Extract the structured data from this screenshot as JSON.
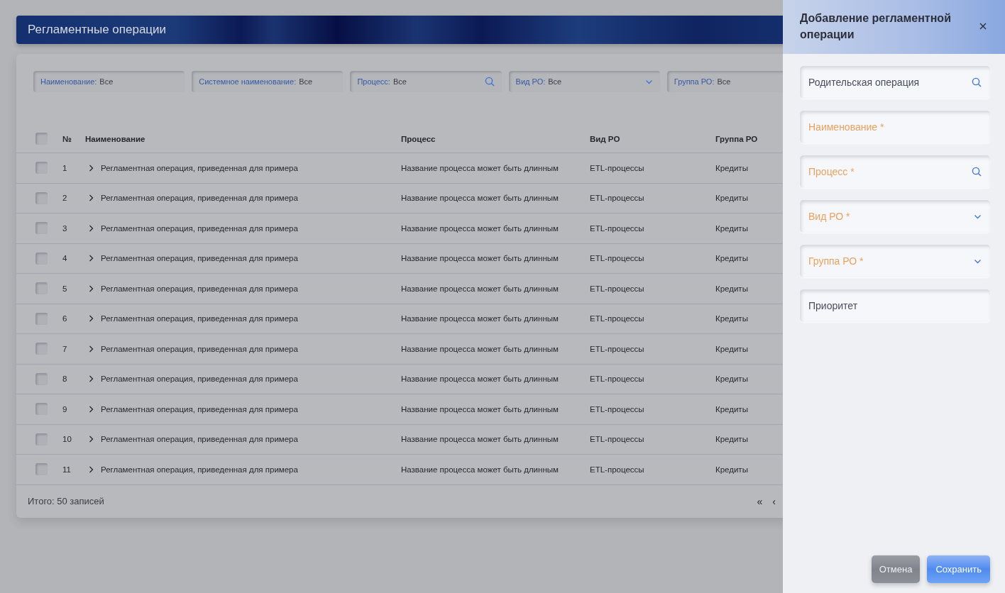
{
  "page": {
    "title": "Регламентные операции"
  },
  "filters": [
    {
      "label": "Наименование:",
      "value": "Все",
      "kind": "text"
    },
    {
      "label": "Системное наименование:",
      "value": "Все",
      "kind": "text"
    },
    {
      "label": "Процесс:",
      "value": "Все",
      "kind": "search"
    },
    {
      "label": "Вид РО:",
      "value": "Все",
      "kind": "dropdown"
    },
    {
      "label": "Группа РО:",
      "value": "Все",
      "kind": "text"
    }
  ],
  "table": {
    "select_all": {
      "checked": false
    },
    "columns": [
      "№",
      "Наименование",
      "Процесс",
      "Вид РО",
      "Группа РО"
    ],
    "rows": [
      {
        "checked": false,
        "expanded": false,
        "cells": [
          "1",
          "Регламентная операция, приведенная для примера",
          "Название процесса может быть длинным",
          "ETL-процессы",
          "Кредиты"
        ]
      },
      {
        "checked": false,
        "expanded": false,
        "cells": [
          "2",
          "Регламентная операция, приведенная для примера",
          "Название процесса может быть длинным",
          "ETL-процессы",
          "Кредиты"
        ]
      },
      {
        "checked": false,
        "expanded": false,
        "cells": [
          "3",
          "Регламентная операция, приведенная для примера",
          "Название процесса может быть длинным",
          "ETL-процессы",
          "Кредиты"
        ]
      },
      {
        "checked": false,
        "expanded": false,
        "cells": [
          "4",
          "Регламентная операция, приведенная для примера",
          "Название процесса может быть длинным",
          "ETL-процессы",
          "Кредиты"
        ]
      },
      {
        "checked": false,
        "expanded": false,
        "cells": [
          "5",
          "Регламентная операция, приведенная для примера",
          "Название процесса может быть длинным",
          "ETL-процессы",
          "Кредиты"
        ]
      },
      {
        "checked": false,
        "expanded": false,
        "cells": [
          "6",
          "Регламентная операция, приведенная для примера",
          "Название процесса может быть длинным",
          "ETL-процессы",
          "Кредиты"
        ]
      },
      {
        "checked": false,
        "expanded": false,
        "cells": [
          "7",
          "Регламентная операция, приведенная для примера",
          "Название процесса может быть длинным",
          "ETL-процессы",
          "Кредиты"
        ]
      },
      {
        "checked": false,
        "expanded": false,
        "cells": [
          "8",
          "Регламентная операция, приведенная для примера",
          "Название процесса может быть длинным",
          "ETL-процессы",
          "Кредиты"
        ]
      },
      {
        "checked": false,
        "expanded": false,
        "cells": [
          "9",
          "Регламентная операция, приведенная для примера",
          "Название процесса может быть длинным",
          "ETL-процессы",
          "Кредиты"
        ]
      },
      {
        "checked": false,
        "expanded": false,
        "cells": [
          "10",
          "Регламентная операция, приведенная для примера",
          "Название процесса может быть длинным",
          "ETL-процессы",
          "Кредиты"
        ]
      },
      {
        "checked": false,
        "expanded": false,
        "cells": [
          "11",
          "Регламентная операция, приведенная для примера",
          "Название процесса может быть длинным",
          "ETL-процессы",
          "Кредиты"
        ]
      }
    ]
  },
  "footer": {
    "total": "Итого: 50 записей",
    "pagination": [
      "«",
      "‹"
    ]
  },
  "drawer": {
    "title": "Добавление регламентной операции",
    "fields": [
      {
        "label": "Родительская операция",
        "required": false,
        "kind": "search"
      },
      {
        "label": "Наименование *",
        "required": true,
        "kind": "text"
      },
      {
        "label": "Процесс *",
        "required": true,
        "kind": "search"
      },
      {
        "label": "Вид РО *",
        "required": true,
        "kind": "dropdown"
      },
      {
        "label": "Группа РО *",
        "required": true,
        "kind": "dropdown"
      },
      {
        "label": "Приоритет",
        "required": false,
        "kind": "text"
      }
    ],
    "buttons": [
      {
        "label": "Отмена",
        "kind": "secondary"
      },
      {
        "label": "Сохранить",
        "kind": "primary"
      }
    ]
  }
}
